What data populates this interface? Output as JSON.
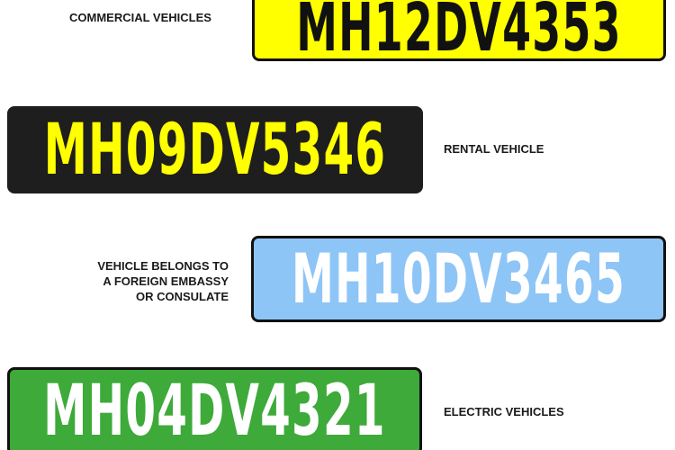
{
  "plates": [
    {
      "number": "MH12DV4353",
      "caption_lines": [
        "COMMERCIAL VEHICLES"
      ],
      "background": "#FFFF00",
      "text_color": "#111111",
      "border_color": "#111111"
    },
    {
      "number": "MH09DV5346",
      "caption_lines": [
        "RENTAL VEHICLE"
      ],
      "background": "#1E1E1E",
      "text_color": "#FFFF00",
      "border_color": "#1E1E1E"
    },
    {
      "number": "MH10DV3465",
      "caption_lines": [
        "VEHICLE BELONGS TO",
        "A FOREIGN EMBASSY",
        "OR CONSULATE"
      ],
      "background": "#8EC5F7",
      "text_color": "#FFFFFF",
      "border_color": "#111111"
    },
    {
      "number": "MH04DV4321",
      "caption_lines": [
        "ELECTRIC VEHICLES"
      ],
      "background": "#3DAA3A",
      "text_color": "#FFFFFF",
      "border_color": "#111111"
    }
  ]
}
